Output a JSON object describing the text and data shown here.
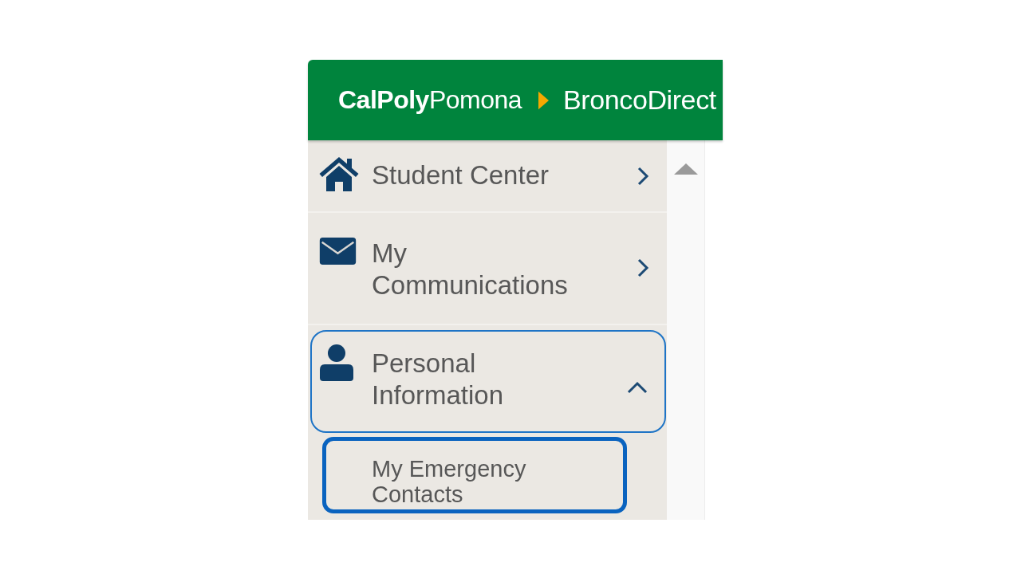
{
  "header": {
    "logo": "**CalPoly**Pomona",
    "app_name": "BroncoDirect"
  },
  "sidebar": {
    "items": [
      {
        "label": "Student Center",
        "selected": false,
        "expanded": false
      },
      {
        "label": "My Communications",
        "selected": false,
        "expanded": false
      },
      {
        "label": "Personal Information",
        "selected": false,
        "expanded": true,
        "children": [
          {
            "label": "My Emergency Contacts",
            "selected": true
          }
        ]
      }
    ]
  }
}
